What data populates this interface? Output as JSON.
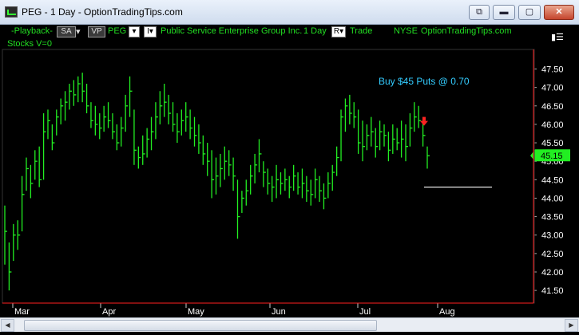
{
  "window": {
    "title": "PEG - 1 Day - OptionTradingTips.com",
    "buttons": [
      "⧉",
      "▬",
      "▢",
      "✕"
    ]
  },
  "toolbar": {
    "playback": "-Playback-",
    "sa": "SA",
    "sa_arrow": "▾",
    "vp": "VP",
    "symbol": "PEG",
    "symbol_arrow": "▾",
    "i_arrow": "I▾",
    "company": "Public Service Enterprise Group Inc.",
    "interval": "1 Day",
    "r_label": "R▾",
    "trade": "Trade",
    "exchange": "NYSE",
    "site": "OptionTradingTips.com",
    "panel_icon": "▮☰"
  },
  "subline": "Stocks  V=0",
  "chart_data": {
    "type": "ohlc",
    "annotation": "Buy $45 Puts @ 0.70",
    "last_price": "45.15",
    "y_ticks": [
      "47.50",
      "47.00",
      "46.50",
      "46.00",
      "45.50",
      "45.00",
      "44.50",
      "44.00",
      "43.50",
      "43.00",
      "42.50",
      "42.00",
      "41.50"
    ],
    "ylim": [
      41.2,
      47.9
    ],
    "x_labels": [
      "Mar",
      "Apr",
      "May",
      "Jun",
      "Jul",
      "Aug"
    ],
    "colors": {
      "bars": "#22ee22",
      "annotation": "#33ccff",
      "arrow": "#ff2222",
      "price_badge": "#22ee22",
      "target_line": "#ffffff"
    },
    "bars": [
      [
        43.8,
        42.2,
        43.1
      ],
      [
        42.8,
        41.5,
        42.0
      ],
      [
        43.3,
        42.3,
        43.0
      ],
      [
        43.4,
        42.6,
        43.0
      ],
      [
        44.6,
        43.1,
        44.1
      ],
      [
        45.1,
        44.2,
        44.8
      ],
      [
        44.9,
        44.0,
        44.4
      ],
      [
        45.3,
        44.5,
        45.0
      ],
      [
        45.4,
        44.3,
        44.5
      ],
      [
        46.3,
        44.5,
        45.8
      ],
      [
        46.4,
        45.6,
        46.1
      ],
      [
        46.0,
        45.3,
        45.5
      ],
      [
        46.4,
        45.7,
        46.2
      ],
      [
        46.7,
        46.0,
        46.5
      ],
      [
        46.9,
        46.1,
        46.6
      ],
      [
        47.1,
        46.4,
        46.9
      ],
      [
        47.2,
        46.5,
        46.8
      ],
      [
        47.3,
        46.6,
        47.1
      ],
      [
        47.4,
        46.6,
        46.9
      ],
      [
        47.1,
        46.3,
        46.5
      ],
      [
        46.6,
        45.9,
        46.1
      ],
      [
        46.5,
        45.7,
        46.0
      ],
      [
        46.3,
        45.6,
        45.9
      ],
      [
        46.5,
        45.8,
        46.2
      ],
      [
        46.6,
        45.9,
        46.1
      ],
      [
        46.3,
        45.6,
        45.8
      ],
      [
        46.0,
        45.3,
        45.5
      ],
      [
        46.2,
        45.4,
        45.9
      ],
      [
        46.8,
        45.8,
        46.5
      ],
      [
        47.3,
        46.2,
        46.9
      ],
      [
        46.4,
        44.9,
        45.3
      ],
      [
        45.4,
        44.8,
        45.1
      ],
      [
        45.7,
        44.9,
        45.2
      ],
      [
        45.9,
        45.1,
        45.6
      ],
      [
        46.2,
        45.3,
        45.8
      ],
      [
        46.6,
        45.6,
        46.2
      ],
      [
        46.9,
        46.0,
        46.5
      ],
      [
        47.1,
        46.2,
        46.6
      ],
      [
        46.8,
        46.0,
        46.3
      ],
      [
        46.6,
        45.8,
        46.0
      ],
      [
        46.3,
        45.5,
        45.8
      ],
      [
        46.4,
        45.7,
        46.1
      ],
      [
        46.6,
        45.8,
        46.2
      ],
      [
        46.4,
        45.6,
        45.9
      ],
      [
        46.2,
        45.4,
        45.7
      ],
      [
        46.0,
        45.2,
        45.5
      ],
      [
        45.7,
        44.9,
        45.2
      ],
      [
        45.5,
        44.6,
        45.0
      ],
      [
        45.3,
        44.0,
        44.5
      ],
      [
        45.1,
        44.1,
        44.6
      ],
      [
        45.2,
        44.3,
        44.8
      ],
      [
        45.4,
        44.5,
        45.0
      ],
      [
        45.3,
        44.6,
        44.9
      ],
      [
        45.1,
        44.2,
        44.6
      ],
      [
        44.5,
        42.9,
        43.5
      ],
      [
        44.2,
        43.6,
        44.0
      ],
      [
        44.5,
        43.8,
        44.2
      ],
      [
        44.9,
        44.1,
        44.6
      ],
      [
        45.2,
        44.4,
        44.9
      ],
      [
        45.6,
        44.7,
        45.2
      ],
      [
        45.0,
        44.3,
        44.7
      ],
      [
        44.8,
        44.1,
        44.4
      ],
      [
        44.6,
        43.9,
        44.3
      ],
      [
        44.9,
        44.0,
        44.5
      ],
      [
        44.7,
        44.1,
        44.4
      ],
      [
        44.8,
        44.2,
        44.5
      ],
      [
        44.6,
        44.0,
        44.3
      ],
      [
        44.9,
        44.2,
        44.6
      ],
      [
        44.7,
        44.1,
        44.3
      ],
      [
        44.8,
        44.0,
        44.4
      ],
      [
        44.6,
        43.9,
        44.2
      ],
      [
        44.5,
        43.8,
        44.1
      ],
      [
        44.8,
        44.0,
        44.5
      ],
      [
        44.6,
        43.9,
        44.2
      ],
      [
        44.4,
        43.7,
        44.0
      ],
      [
        44.7,
        44.0,
        44.4
      ],
      [
        44.9,
        44.2,
        44.7
      ],
      [
        45.4,
        44.6,
        45.1
      ],
      [
        46.4,
        45.0,
        46.2
      ],
      [
        46.7,
        45.8,
        46.5
      ],
      [
        46.8,
        46.0,
        46.3
      ],
      [
        46.6,
        45.9,
        46.2
      ],
      [
        46.4,
        45.2,
        45.5
      ],
      [
        46.1,
        45.0,
        45.4
      ],
      [
        46.0,
        45.3,
        45.7
      ],
      [
        46.2,
        45.4,
        45.8
      ],
      [
        45.9,
        45.1,
        45.4
      ],
      [
        46.1,
        45.3,
        45.8
      ],
      [
        46.0,
        45.4,
        45.7
      ],
      [
        45.8,
        45.0,
        45.3
      ],
      [
        46.0,
        45.2,
        45.6
      ],
      [
        45.9,
        45.3,
        45.5
      ],
      [
        46.1,
        45.1,
        45.6
      ],
      [
        46.0,
        45.0,
        45.4
      ],
      [
        46.3,
        45.4,
        45.9
      ],
      [
        46.6,
        45.8,
        46.2
      ],
      [
        46.5,
        45.9,
        46.1
      ],
      [
        46.2,
        45.4,
        45.7
      ],
      [
        45.4,
        44.8,
        45.15
      ]
    ]
  }
}
